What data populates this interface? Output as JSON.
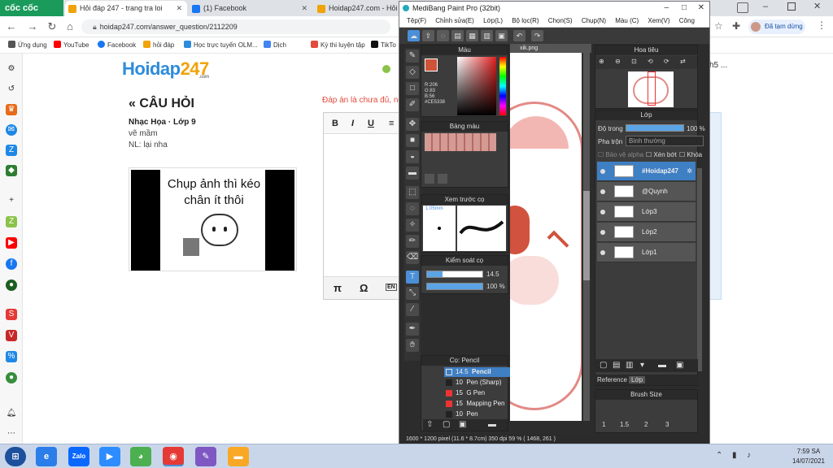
{
  "browser": {
    "brand": "cốc cốc",
    "tabs": [
      {
        "label": "Hỏi đáp 247 - trang tra loi",
        "icon_color": "#f0a30a"
      },
      {
        "label": "(1) Facebook",
        "icon_color": "#1877f2"
      },
      {
        "label": "Hoidap247.com - Hỏi",
        "icon_color": "#f0a30a"
      }
    ],
    "url": "hoidap247.com/answer_question/2112209",
    "profile_label": "Đã tạm dừng",
    "bookmarks": [
      {
        "label": "Ứng dụng",
        "color": "#555"
      },
      {
        "label": "YouTube",
        "color": "#ff0000"
      },
      {
        "label": "Facebook",
        "color": "#1877f2"
      },
      {
        "label": "hỏi đáp",
        "color": "#f0a30a"
      },
      {
        "label": "Học trực tuyến OLM...",
        "color": "#2d8cdb"
      },
      {
        "label": "Dịch",
        "color": "#4285f4"
      },
      {
        "label": "Kỳ thi luyện tập",
        "color": "#e34b3c"
      },
      {
        "label": "TikTo",
        "color": "#111"
      }
    ]
  },
  "page": {
    "logo_main": "Hoidap",
    "logo_num": "247",
    "logo_sub": ".com",
    "question_header": "« CÂU HỎI",
    "question_meta": "Nhạc Họa · Lớp 9",
    "question_line1": "vẽ mầm",
    "question_line2": "NL: lại nha",
    "image_caption": "Chụp ảnh thì kéo chân ít thôi",
    "answer_hint": "Đáp án là chưa đủ, ng",
    "right_fragment": "h5 ...",
    "editor_buttons": [
      "B",
      "I",
      "U"
    ],
    "editor_symbols": [
      "π",
      "Ω",
      "EN"
    ]
  },
  "medibang": {
    "title": "MediBang Paint Pro (32bit)",
    "menu": [
      "Tệp(F)",
      "Chỉnh sửa(E)",
      "Lớp(L)",
      "Bộ lọc(R)",
      "Chọn(S)",
      "Chụp(N)",
      "Màu (C)",
      "Xem(V)",
      "Công cụ(T)"
    ],
    "color_panel": "Màu",
    "rgb": [
      "R:206",
      "G:83",
      "B:56",
      "#CE5338"
    ],
    "swatch_panel": "Bảng màu",
    "preview_panel": "Xem trước cọ",
    "brush_size_label": "1.05mm",
    "brush_control": "Kiểm soát cọ",
    "size_value": "14.5",
    "opacity_value": "100 %",
    "brush_list_header": "Cọ: Pencil",
    "brushes": [
      {
        "size": "14.5",
        "name": "Pencil"
      },
      {
        "size": "10",
        "name": "Pen (Sharp)"
      },
      {
        "size": "15",
        "name": "G Pen"
      },
      {
        "size": "15",
        "name": "Mapping Pen"
      },
      {
        "size": "10",
        "name": "Pen"
      }
    ],
    "canvas_tab": "xik.png",
    "navigator": "Hoa tiêu",
    "layer_panel": "Lớp",
    "opacity_label": "Độ trong",
    "layer_opacity": "100 %",
    "blend_label": "Pha trộn",
    "blend_value": "Bình thường",
    "options": [
      "Bảo vệ alpha",
      "Xén bớt",
      "Khóa"
    ],
    "layers": [
      "#Hoidap247",
      "@Quynh",
      "Lớp3",
      "Lớp2",
      "Lớp1"
    ],
    "ref_tabs": [
      "Reference",
      "Lớp"
    ],
    "brush_size_panel": "Brush Size",
    "brush_sizes": [
      "1",
      "1.5",
      "2",
      "3"
    ],
    "status": "1600 * 1200 pixel  (11.6 * 8.7cm)  350 dpi  59 %  ( 1468, 261 )"
  },
  "taskbar": {
    "time": "7:59 SA",
    "date": "14/07/2021"
  },
  "colors": {
    "brush_color": "#CE5338",
    "layer_selected": "#3f7fc4",
    "accent": "#2d8cdb"
  }
}
